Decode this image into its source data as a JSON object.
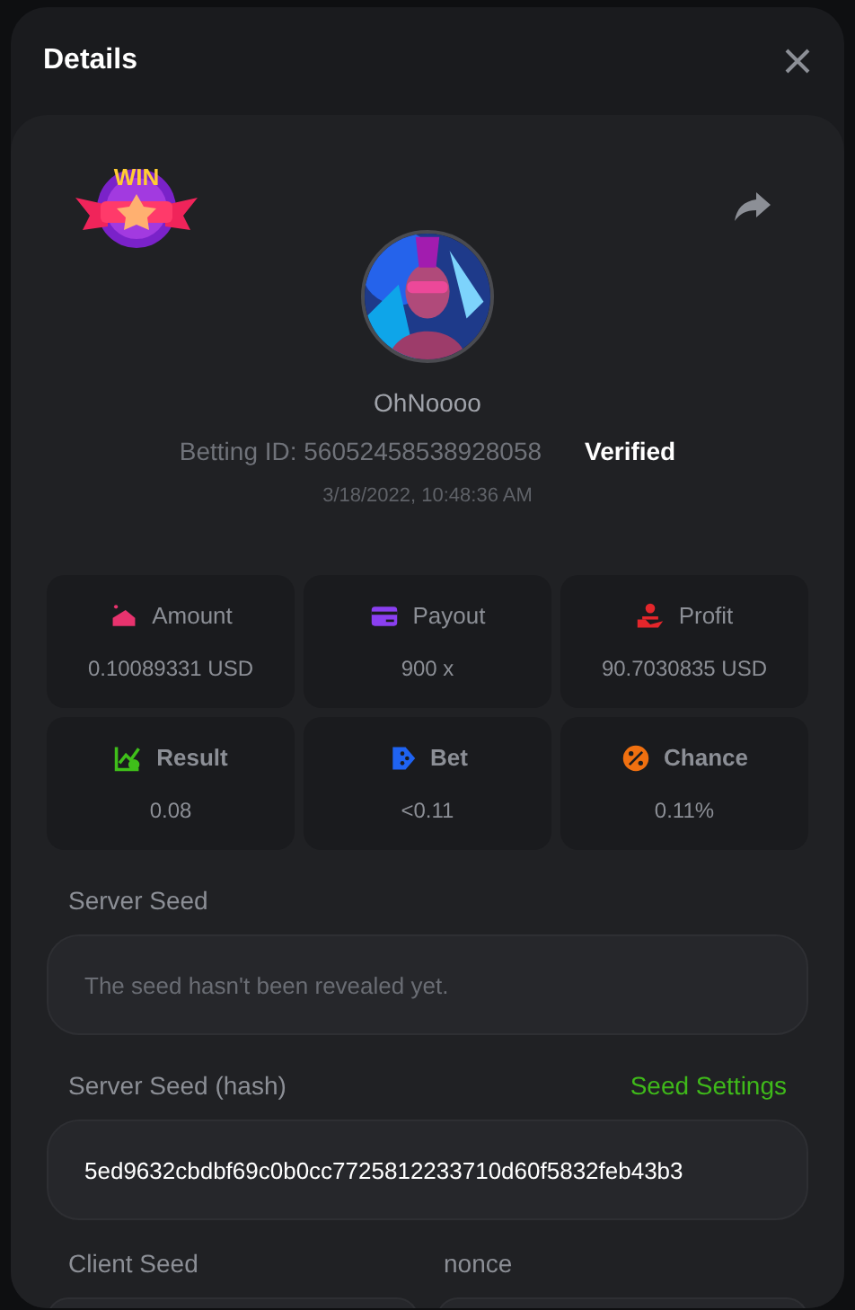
{
  "window": {
    "title": "Details"
  },
  "user": {
    "name": "OhNoooo",
    "betting_id": "Betting ID: 56052458538928058",
    "verified": "Verified",
    "time": "3/18/2022, 10:48:36 AM",
    "badge": "WIN"
  },
  "stats": [
    {
      "kind": "amount",
      "label": "Amount",
      "value": "0.10089331 USD",
      "color": "#e8336e",
      "bold_label": false
    },
    {
      "kind": "payout",
      "label": "Payout",
      "value": "900 x",
      "color": "#8a3ff0",
      "bold_label": false
    },
    {
      "kind": "profit",
      "label": "Profit",
      "value": "90.7030835 USD",
      "color": "#e3262b",
      "bold_label": false
    },
    {
      "kind": "result",
      "label": "Result",
      "value": "0.08",
      "color": "#3fbf1a",
      "bold_label": true
    },
    {
      "kind": "bet",
      "label": "Bet",
      "value": "<0.11",
      "color": "#1f63f2",
      "bold_label": true
    },
    {
      "kind": "chance",
      "label": "Chance",
      "value": "0.11%",
      "color": "#f07010",
      "bold_label": true
    }
  ],
  "server_seed": {
    "label": "Server Seed",
    "placeholder": "The seed hasn't been revealed yet."
  },
  "server_seed_hash": {
    "label": "Server Seed (hash)",
    "link": "Seed Settings",
    "value": "5ed9632cbdbf69c0b0cc7725812233710d60f5832feb43b3"
  },
  "client_seed": {
    "label": "Client Seed"
  },
  "nonce": {
    "label": "nonce"
  }
}
